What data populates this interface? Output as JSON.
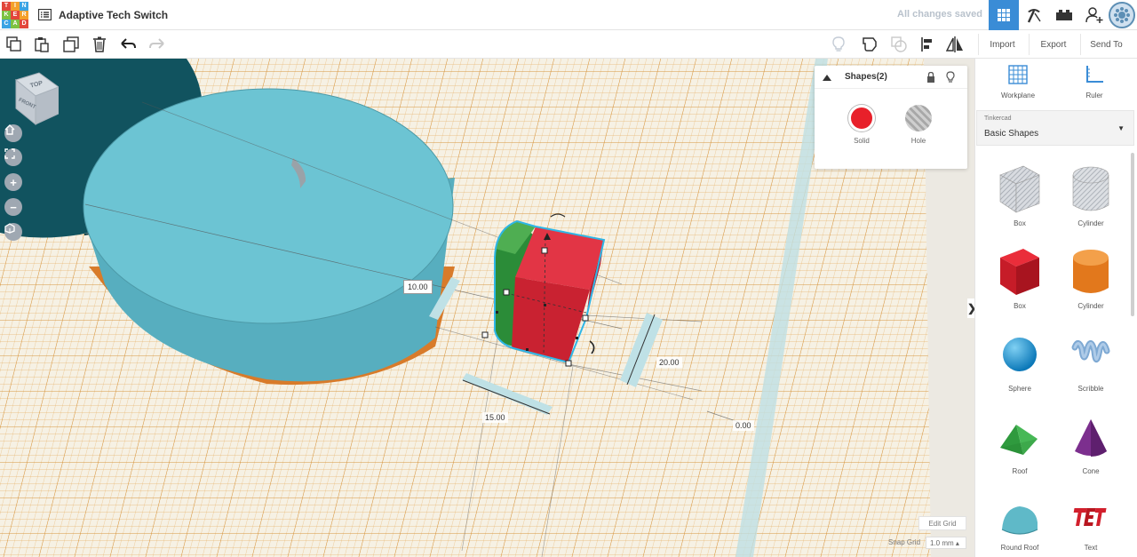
{
  "app": {
    "logo_letters": [
      "T",
      "I",
      "N",
      "K",
      "E",
      "R",
      "C",
      "A",
      "D"
    ],
    "logo_colors": [
      "#e2463b",
      "#f4a02a",
      "#3aa3e3",
      "#7dc242",
      "#e2463b",
      "#f4a02a",
      "#3aa3e3",
      "#7dc242",
      "#e2463b"
    ],
    "document_title": "Adaptive Tech Switch",
    "save_status": "All changes saved"
  },
  "topbar": {
    "icons": [
      "grid-view-icon",
      "pickaxe-icon",
      "bricks-icon",
      "add-user-icon",
      "user-avatar"
    ]
  },
  "toolbar": {
    "import_label": "Import",
    "export_label": "Export",
    "send_to_label": "Send To"
  },
  "viewcube": {
    "top_label": "TOP",
    "front_label": "FRONT"
  },
  "dimensions": {
    "width": "15.00",
    "depth": "20.00",
    "height": "10.00",
    "elevation": "0.00"
  },
  "inspector": {
    "title": "Shapes(2)",
    "solid_label": "Solid",
    "hole_label": "Hole",
    "solid_color": "#e8202a"
  },
  "grid": {
    "edit_label": "Edit Grid",
    "snap_label": "Snap Grid",
    "snap_value": "1.0 mm ▴"
  },
  "panel": {
    "workplane_label": "Workplane",
    "ruler_label": "Ruler",
    "library_source": "Tinkercad",
    "library_name": "Basic Shapes",
    "shapes": [
      {
        "label": "Box",
        "icon": "box-striped"
      },
      {
        "label": "Cylinder",
        "icon": "cylinder-striped"
      },
      {
        "label": "Box",
        "icon": "box-red"
      },
      {
        "label": "Cylinder",
        "icon": "cylinder-orange"
      },
      {
        "label": "Sphere",
        "icon": "sphere-blue"
      },
      {
        "label": "Scribble",
        "icon": "scribble-blue"
      },
      {
        "label": "Roof",
        "icon": "roof-green"
      },
      {
        "label": "Cone",
        "icon": "cone-purple"
      },
      {
        "label": "Round Roof",
        "icon": "round-roof-teal"
      },
      {
        "label": "Text",
        "icon": "text-red"
      }
    ]
  }
}
